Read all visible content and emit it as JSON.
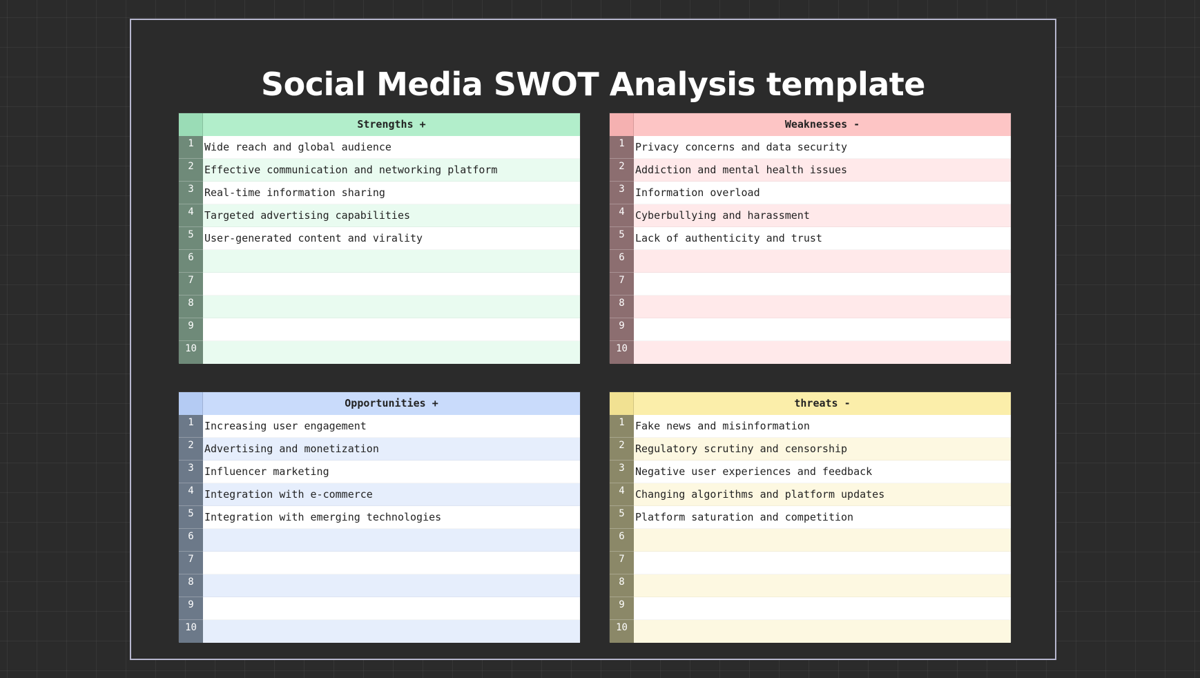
{
  "title": "Social Media SWOT Analysis template",
  "quadrants": [
    {
      "header": "Strengths +",
      "colors": {
        "header": "#b2eecb",
        "corner": "#9adcb6",
        "num": "#6f8a79",
        "alt": "#e9fbf0",
        "base": "#ffffff"
      },
      "rows": [
        "Wide reach and global audience",
        "Effective communication and networking platform",
        "Real-time information sharing",
        "Targeted advertising capabilities",
        "User-generated content and virality",
        "",
        "",
        "",
        "",
        ""
      ]
    },
    {
      "header": "Weaknesses -",
      "colors": {
        "header": "#fdc5c5",
        "corner": "#f5b1b1",
        "num": "#8c6e70",
        "alt": "#ffe9ea",
        "base": "#ffffff"
      },
      "rows": [
        "Privacy concerns and data security",
        "Addiction and mental health issues",
        "Information overload",
        "Cyberbullying and harassment",
        "Lack of authenticity and trust",
        "",
        "",
        "",
        "",
        ""
      ]
    },
    {
      "header": "Opportunities +",
      "colors": {
        "header": "#c9dbfb",
        "corner": "#b4cbf3",
        "num": "#6c7989",
        "alt": "#e6eefc",
        "base": "#ffffff"
      },
      "rows": [
        "Increasing user engagement",
        "Advertising and monetization",
        "Influencer marketing",
        "Integration with e-commerce",
        "Integration with emerging technologies",
        "",
        "",
        "",
        "",
        ""
      ]
    },
    {
      "header": "threats -",
      "colors": {
        "header": "#fbeeaa",
        "corner": "#f1e192",
        "num": "#8b8868",
        "alt": "#fdf8e1",
        "base": "#ffffff"
      },
      "rows": [
        "Fake news and misinformation",
        "Regulatory scrutiny and censorship",
        "Negative user experiences and feedback",
        "Changing algorithms and platform updates",
        "Platform saturation and competition",
        "",
        "",
        "",
        "",
        ""
      ]
    }
  ]
}
